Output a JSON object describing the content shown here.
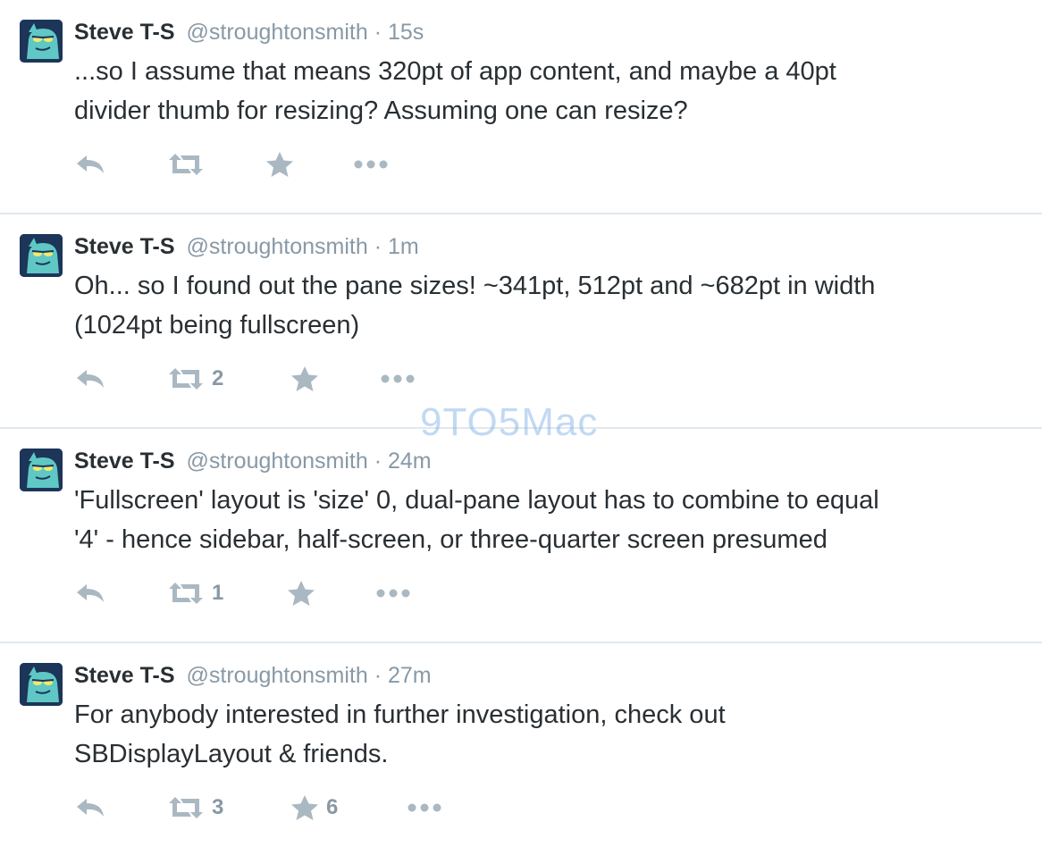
{
  "tweets": [
    {
      "name": "Steve T-S",
      "handle": "@stroughtonsmith",
      "separator": "·",
      "time": "15s",
      "text_lines": [
        "...so I assume that means 320pt of app content, and maybe a 40pt",
        "divider thumb for resizing? Assuming one can resize?"
      ],
      "retweet_count": "",
      "favorite_count": ""
    },
    {
      "name": "Steve T-S",
      "handle": "@stroughtonsmith",
      "separator": "·",
      "time": "1m",
      "text_lines": [
        "Oh... so I found out the pane sizes! ~341pt, 512pt and ~682pt in width",
        "(1024pt being fullscreen)"
      ],
      "retweet_count": "2",
      "favorite_count": ""
    },
    {
      "name": "Steve T-S",
      "handle": "@stroughtonsmith",
      "separator": "·",
      "time": "24m",
      "text_lines": [
        "'Fullscreen' layout is 'size' 0, dual-pane layout has to combine to equal",
        "'4' - hence sidebar, half-screen, or three-quarter screen presumed"
      ],
      "retweet_count": "1",
      "favorite_count": ""
    },
    {
      "name": "Steve T-S",
      "handle": "@stroughtonsmith",
      "separator": "·",
      "time": "27m",
      "text_lines": [
        "For anybody interested in further investigation, check out",
        "SBDisplayLayout & friends."
      ],
      "retweet_count": "3",
      "favorite_count": "6"
    }
  ],
  "icons": {
    "reply": "reply-icon",
    "retweet": "retweet-icon",
    "favorite": "star-icon",
    "more": "more-dots-icon"
  },
  "colors": {
    "text": "#292f33",
    "muted": "#8899a6",
    "icon": "#aab8c2",
    "divider": "#e1e8ed",
    "watermark": "#78aae6"
  },
  "watermark": "9TO5Mac"
}
